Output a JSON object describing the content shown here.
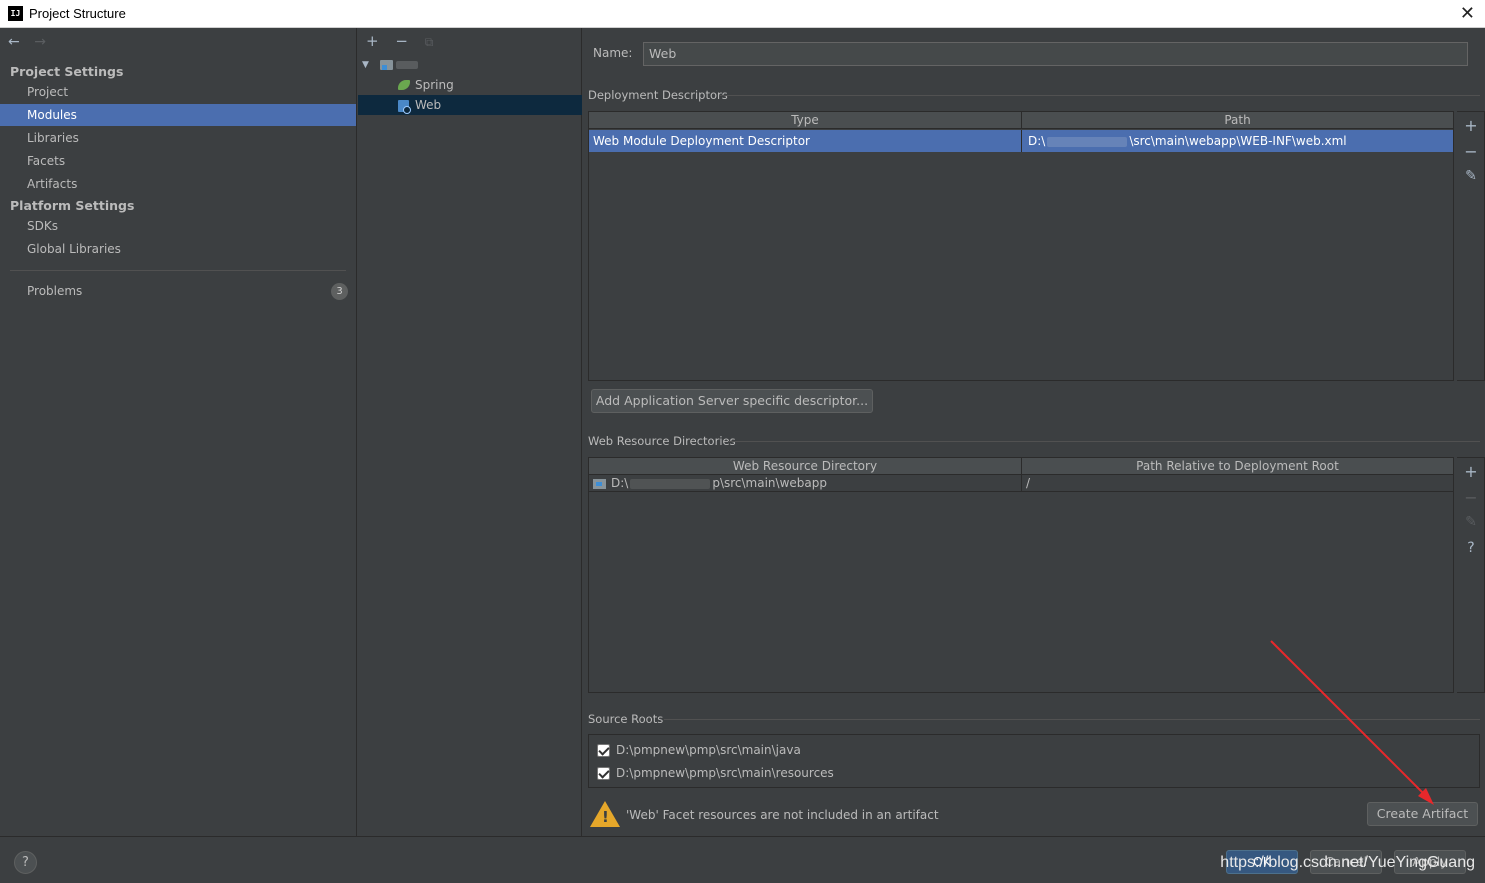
{
  "window": {
    "app_icon_text": "IJ",
    "title": "Project Structure",
    "close_glyph": "✕"
  },
  "nav": {
    "back_glyph": "←",
    "forward_glyph": "→",
    "project_settings": "Project Settings",
    "project_items": [
      "Project",
      "Modules",
      "Libraries",
      "Facets",
      "Artifacts"
    ],
    "platform_settings": "Platform Settings",
    "platform_items": [
      "SDKs",
      "Global Libraries"
    ],
    "problems": "Problems",
    "problems_count": "3",
    "selected": "Modules"
  },
  "tree": {
    "add_glyph": "+",
    "remove_glyph": "−",
    "copy_glyph": "⧉",
    "expand_glyph": "▼",
    "children": [
      "Spring",
      "Web"
    ],
    "selected": "Web"
  },
  "content": {
    "name_label": "Name:",
    "name_value": "Web",
    "deployment": {
      "title": "Deployment Descriptors",
      "col_type": "Type",
      "col_path": "Path",
      "row_type": "Web Module Deployment Descriptor",
      "row_path_prefix": "D:\\",
      "row_path_suffix": "\\src\\main\\webapp\\WEB-INF\\web.xml",
      "add_server_button": "Add Application Server specific descriptor..."
    },
    "web_resources": {
      "title": "Web Resource Directories",
      "col_dir": "Web Resource Directory",
      "col_rel": "Path Relative to Deployment Root",
      "row_dir_prefix": "D:\\",
      "row_dir_suffix": "p\\src\\main\\webapp",
      "row_rel": "/"
    },
    "source_roots": {
      "title": "Source Roots",
      "items": [
        "D:\\pmpnew\\pmp\\src\\main\\java",
        "D:\\pmpnew\\pmp\\src\\main\\resources"
      ]
    },
    "warning_text": "'Web' Facet resources are not included in an artifact",
    "create_artifact_button": "Create Artifact"
  },
  "side_tools": {
    "add": "+",
    "remove": "−",
    "edit": "✎",
    "help": "?"
  },
  "footer": {
    "help": "?",
    "ok": "OK",
    "cancel": "Cancel",
    "apply": "Apply",
    "watermark": "https://blog.csdn.net/YueYingGuang"
  },
  "colors": {
    "selection": "#4b6eaf",
    "tree_selection": "#0d293e",
    "warning": "#e5a72a",
    "annotation_arrow": "#e8282b"
  }
}
